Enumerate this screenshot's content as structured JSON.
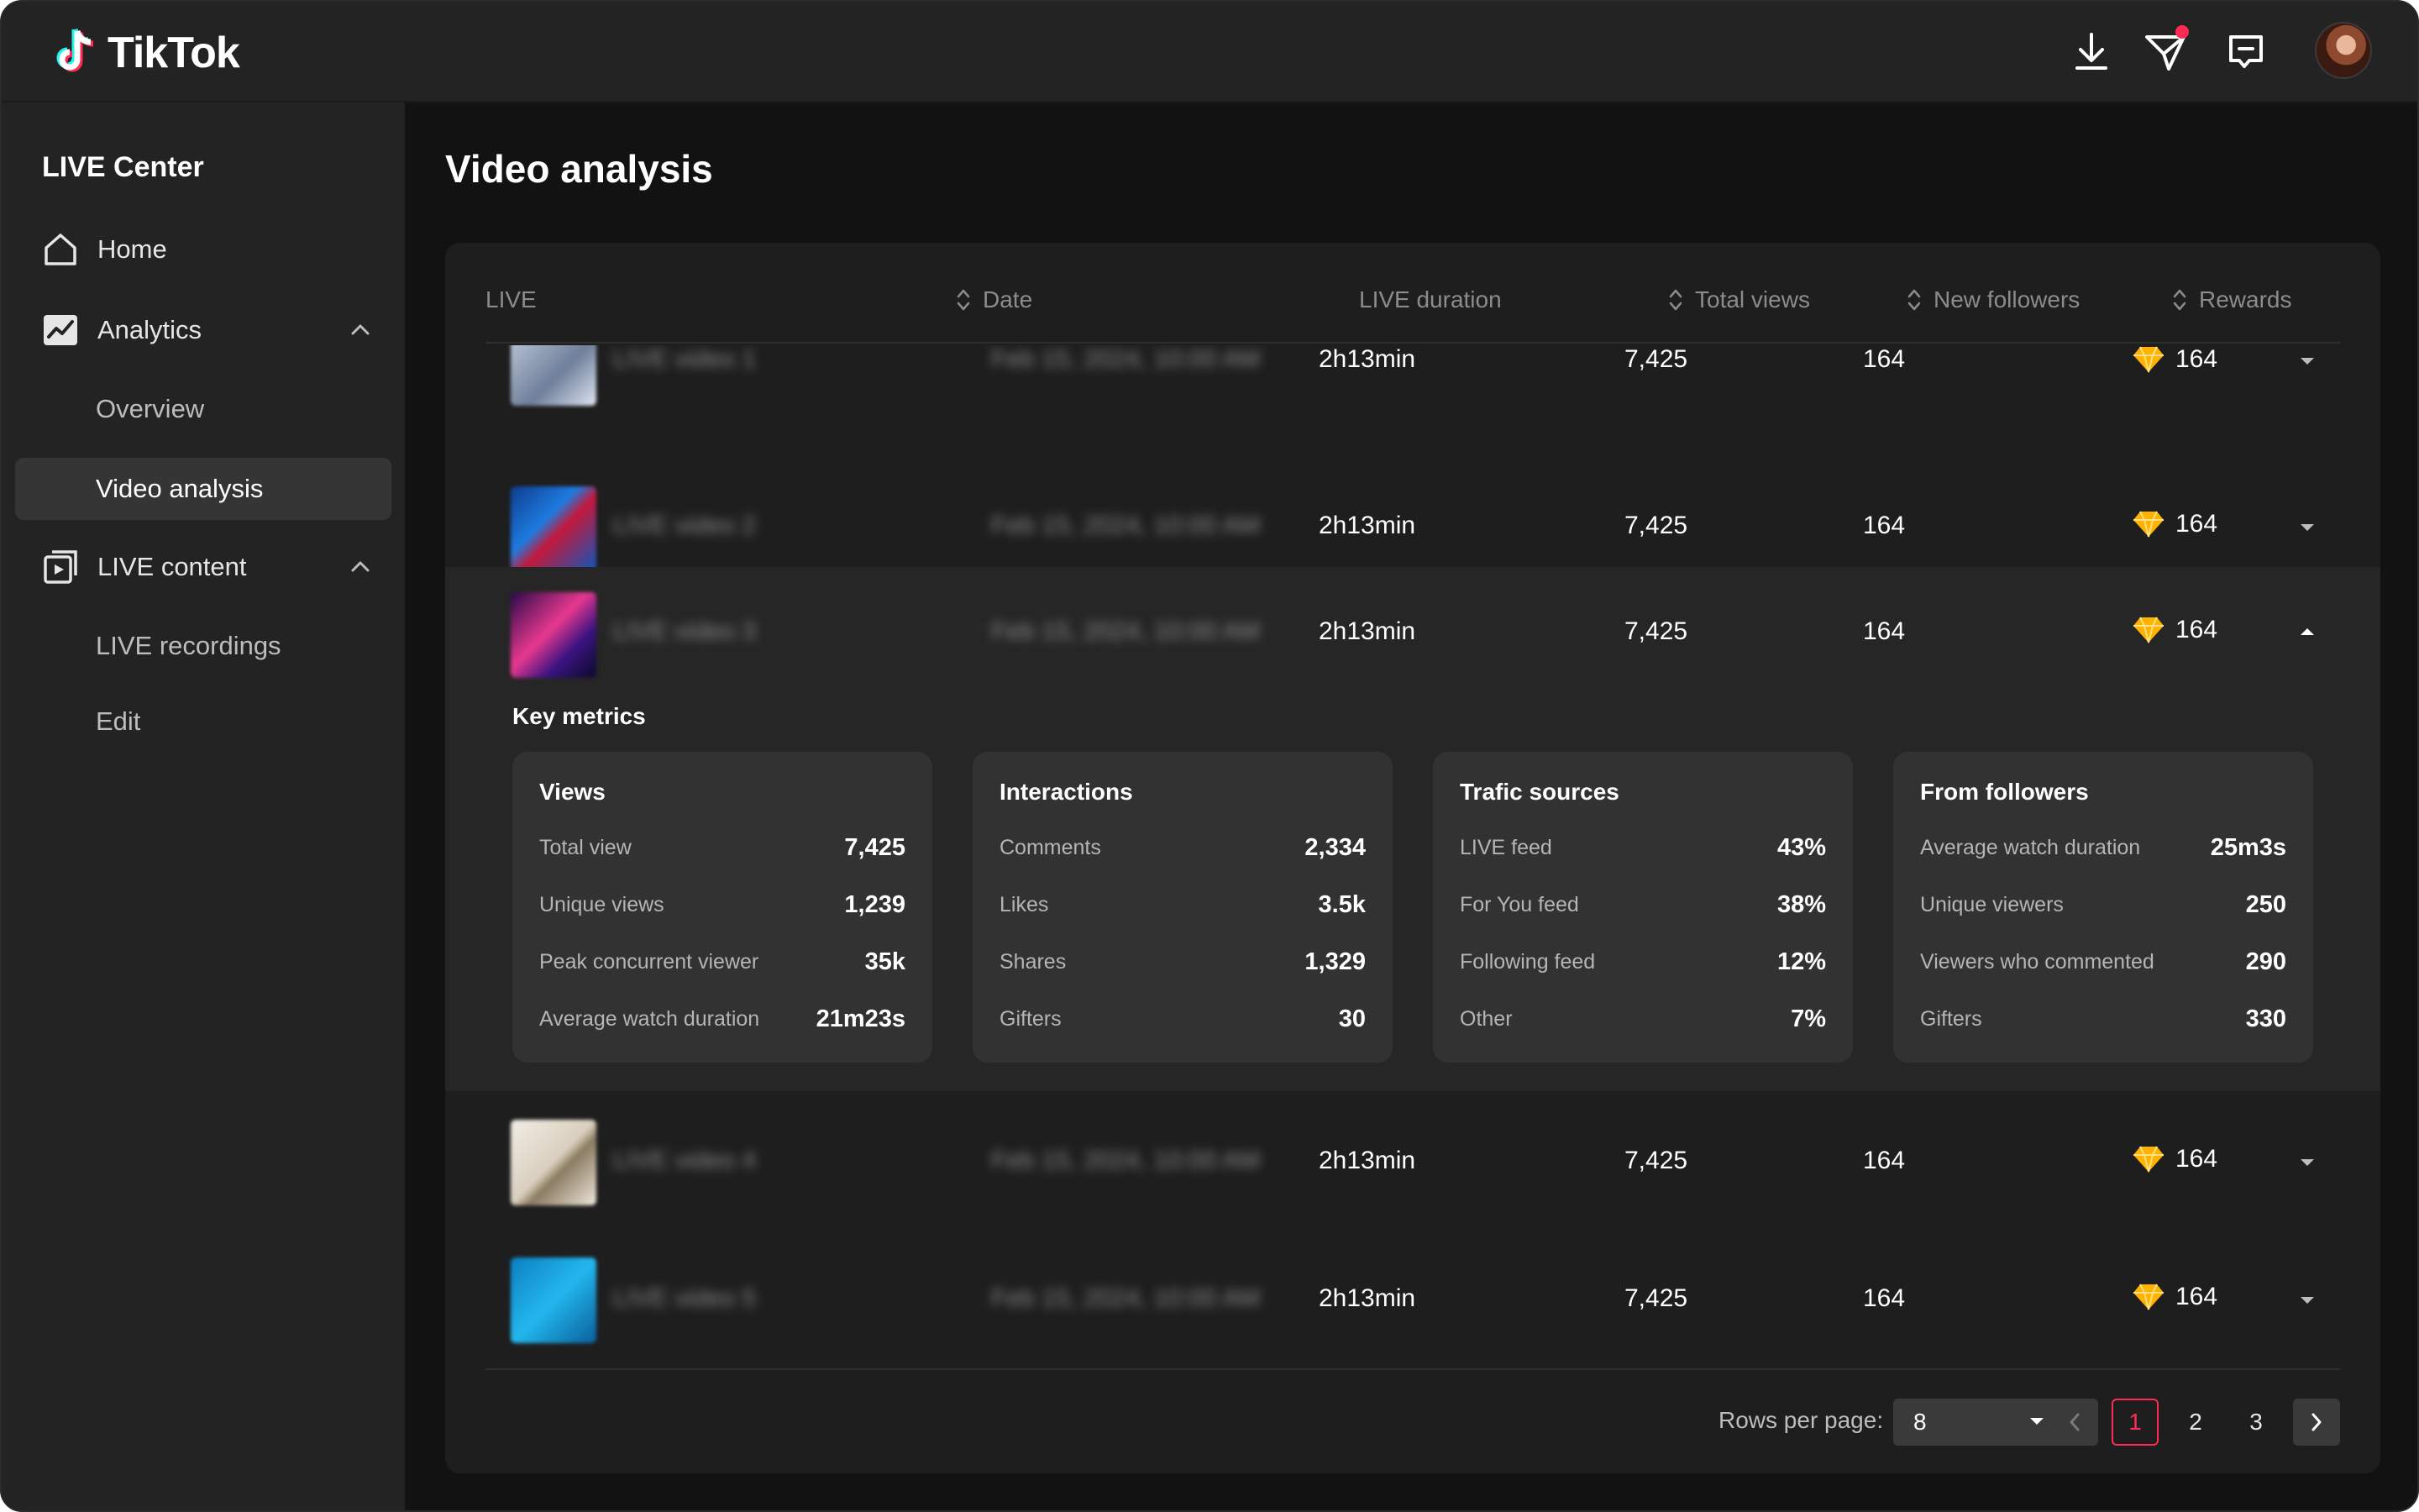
{
  "app": {
    "name": "TikTok"
  },
  "topbar": {
    "icons": [
      "download-icon",
      "send-icon",
      "message-icon"
    ],
    "has_notification": true
  },
  "sidebar": {
    "title": "LIVE Center",
    "items": [
      {
        "label": "Home",
        "icon": "home-icon"
      },
      {
        "label": "Analytics",
        "icon": "analytics-icon",
        "expanded": true,
        "children": [
          "Overview",
          "Video analysis"
        ]
      },
      {
        "label": "LIVE content",
        "icon": "live-content-icon",
        "expanded": true,
        "children": [
          "LIVE recordings",
          "Edit"
        ]
      }
    ],
    "active": "Video analysis"
  },
  "page": {
    "title": "Video analysis"
  },
  "table": {
    "headers": [
      "LIVE",
      "Date",
      "LIVE duration",
      "Total views",
      "New followers",
      "Rewards"
    ],
    "rows": [
      {
        "name": "LIVE video 1",
        "date": "Feb 15, 2024, 10:00 AM",
        "duration": "2h13min",
        "views": "7,425",
        "followers": "164",
        "rewards": "164"
      },
      {
        "name": "LIVE video 2",
        "date": "Feb 15, 2024, 10:00 AM",
        "duration": "2h13min",
        "views": "7,425",
        "followers": "164",
        "rewards": "164"
      },
      {
        "name": "LIVE video 3",
        "date": "Feb 15, 2024, 10:00 AM",
        "duration": "2h13min",
        "views": "7,425",
        "followers": "164",
        "rewards": "164"
      },
      {
        "name": "LIVE video 4",
        "date": "Feb 15, 2024, 10:00 AM",
        "duration": "2h13min",
        "views": "7,425",
        "followers": "164",
        "rewards": "164"
      },
      {
        "name": "LIVE video 5",
        "date": "Feb 15, 2024, 10:00 AM",
        "duration": "2h13min",
        "views": "7,425",
        "followers": "164",
        "rewards": "164"
      }
    ],
    "expanded_row": 3
  },
  "key_metrics": {
    "title": "Key metrics",
    "cards": [
      {
        "title": "Views",
        "items": [
          {
            "label": "Total view",
            "value": "7,425"
          },
          {
            "label": "Unique views",
            "value": "1,239"
          },
          {
            "label": "Peak concurrent viewer",
            "value": "35k"
          },
          {
            "label": "Average watch duration",
            "value": "21m23s"
          }
        ]
      },
      {
        "title": "Interactions",
        "items": [
          {
            "label": "Comments",
            "value": "2,334"
          },
          {
            "label": "Likes",
            "value": "3.5k"
          },
          {
            "label": "Shares",
            "value": "1,329"
          },
          {
            "label": "Gifters",
            "value": "30"
          }
        ]
      },
      {
        "title": "Trafic sources",
        "items": [
          {
            "label": "LIVE feed",
            "value": "43%"
          },
          {
            "label": "For You feed",
            "value": "38%"
          },
          {
            "label": "Following feed",
            "value": "12%"
          },
          {
            "label": "Other",
            "value": "7%"
          }
        ]
      },
      {
        "title": "From followers",
        "items": [
          {
            "label": "Average watch duration",
            "value": "25m3s"
          },
          {
            "label": "Unique viewers",
            "value": "250"
          },
          {
            "label": "Viewers who commented",
            "value": "290"
          },
          {
            "label": "Gifters",
            "value": "330"
          }
        ]
      }
    ]
  },
  "pagination": {
    "rows_per_page_label": "Rows per page:",
    "rows_per_page": "8",
    "pages": [
      "1",
      "2",
      "3"
    ],
    "current": "1"
  },
  "colors": {
    "accent": "#fe2c55",
    "background": "#121212",
    "panel": "#1e1e1e",
    "card": "#323232"
  }
}
